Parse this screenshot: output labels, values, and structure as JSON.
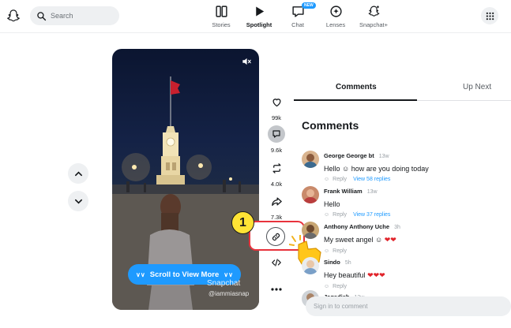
{
  "search": {
    "placeholder": "Search"
  },
  "nav": [
    {
      "label": "Stories",
      "icon": "stories-icon"
    },
    {
      "label": "Spotlight",
      "icon": "spotlight-play-icon"
    },
    {
      "label": "Chat",
      "icon": "chat-icon",
      "badge": "NEW"
    },
    {
      "label": "Lenses",
      "icon": "lenses-icon"
    },
    {
      "label": "Snapchat+",
      "icon": "snapchat-plus-icon"
    }
  ],
  "video": {
    "scroll_label": "Scroll to View More",
    "watermark_brand": "Snapchat",
    "watermark_handle": "@iammiasnap"
  },
  "actions": {
    "likes": "99k",
    "comments": "9.6k",
    "shares": "4.0k",
    "sends": "7.3k"
  },
  "step_number": "1",
  "tabs": {
    "comments": "Comments",
    "up_next": "Up Next"
  },
  "comments_title": "Comments",
  "comments": [
    {
      "name": "George George bt",
      "time": "13w",
      "text": "Hello ☺ how are you doing today",
      "reply": "Reply",
      "view_replies": "View 58 replies"
    },
    {
      "name": "Frank William",
      "time": "13w",
      "text": "Hello",
      "reply": "Reply",
      "view_replies": "View 37 replies"
    },
    {
      "name": "Anthony Anthony Uche",
      "time": "3h",
      "text": "My sweet angel ☺",
      "reply": "Reply",
      "view_replies": ""
    },
    {
      "name": "Sindo",
      "time": "5h",
      "text": "Hey beautiful",
      "reply": "Reply",
      "view_replies": ""
    },
    {
      "name": "Jagadish",
      "time": "13w",
      "text": "",
      "reply": "",
      "view_replies": ""
    }
  ],
  "comment_input": {
    "placeholder": "Sign in to comment"
  },
  "colors": {
    "accent_blue": "#1e9aff",
    "highlight_red": "#e8323c",
    "step_yellow": "#ffe335",
    "heart_red": "#e1242b"
  }
}
